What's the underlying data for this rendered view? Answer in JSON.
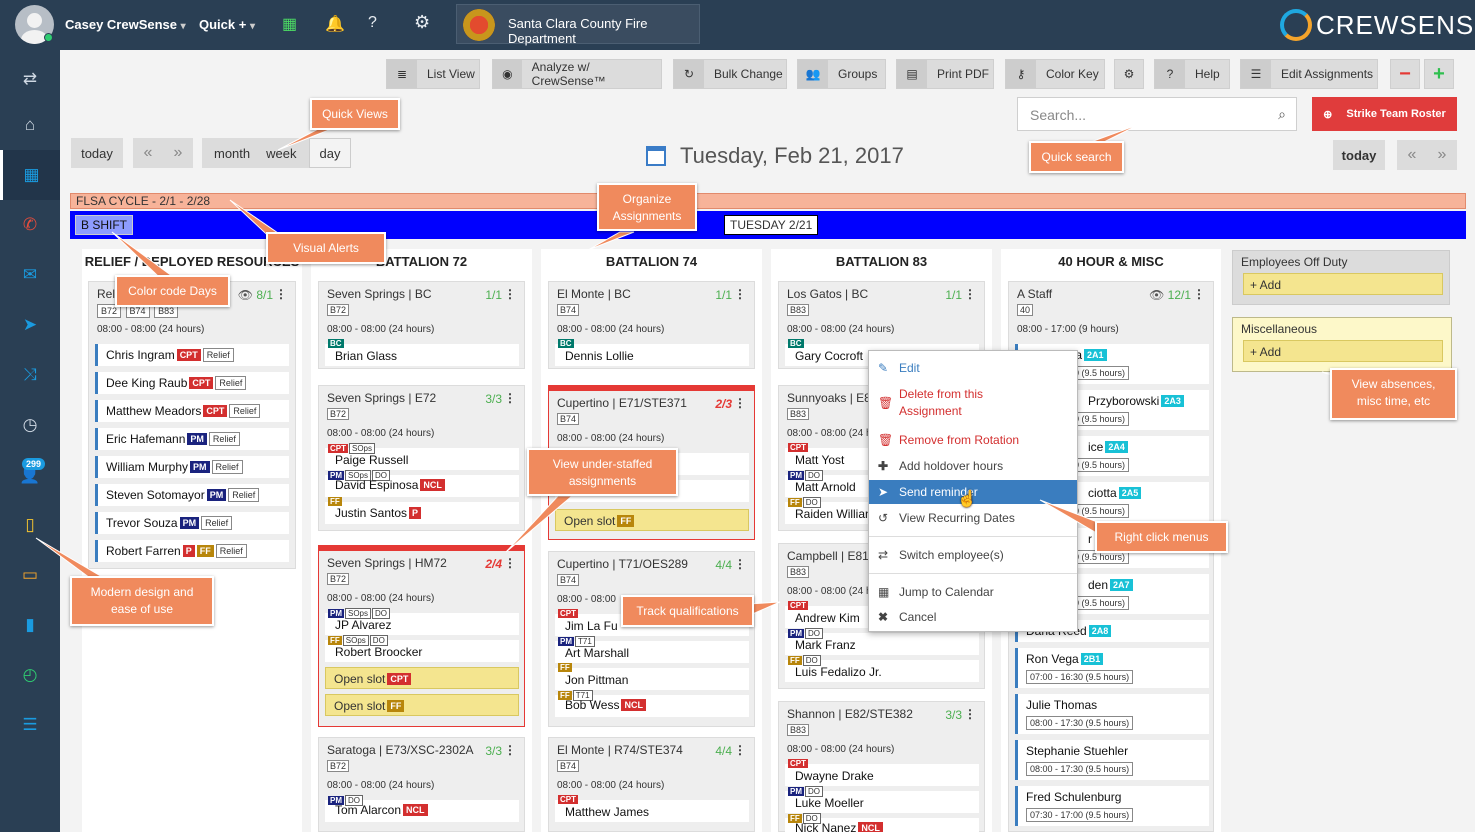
{
  "topbar": {
    "user_name": "Casey CrewSense",
    "user_caret": "▾",
    "quick_label": "Quick +",
    "quick_caret": "▾",
    "department": "Santa Clara County Fire Department",
    "brand": "CREWSENSE"
  },
  "sidebar": {
    "badge_count": "299"
  },
  "toolbar": {
    "list_view": "List View",
    "analyze": "Analyze w/ CrewSense™",
    "bulk_change": "Bulk Change",
    "groups": "Groups",
    "print_pdf": "Print PDF",
    "color_key": "Color Key",
    "help": "Help",
    "edit_assignments": "Edit Assignments",
    "minus": "−",
    "plus": "+"
  },
  "search": {
    "placeholder": "Search..."
  },
  "strike_team": "Strike Team Roster",
  "nav": {
    "today": "today",
    "prev": "«",
    "next": "»",
    "views": [
      "month",
      "week",
      "day"
    ]
  },
  "date_heading": "Tuesday, Feb 21, 2017",
  "flsa_cycle": "FLSA CYCLE - 2/1 - 2/28",
  "shift_label": "B SHIFT",
  "day_label": "TUESDAY 2/21",
  "columns": {
    "relief": "RELIEF / DEPLOYED RESOURCES",
    "b72": "BATTALION 72",
    "b74": "BATTALION 74",
    "b83": "BATTALION 83",
    "misc40": "40 HOUR & MISC"
  },
  "relief_card": {
    "title": "Rel",
    "count": "8/1",
    "apps": [
      "B72",
      "B74",
      "B83"
    ],
    "hours": "08:00 - 08:00 (24 hours)",
    "people": [
      {
        "name": "Chris Ingram",
        "tags": [
          "CPT"
        ]
      },
      {
        "name": "Dee King Raub",
        "tags": [
          "CPT"
        ]
      },
      {
        "name": "Matthew Meadors",
        "tags": [
          "CPT"
        ]
      },
      {
        "name": "Eric Hafemann",
        "tags": [
          "PM"
        ]
      },
      {
        "name": "William Murphy",
        "tags": [
          "PM"
        ]
      },
      {
        "name": "Steven Sotomayor",
        "tags": [
          "PM"
        ]
      },
      {
        "name": "Trevor Souza",
        "tags": [
          "PM"
        ]
      },
      {
        "name": "Robert Farren",
        "tags": [
          "P",
          "FF"
        ]
      }
    ],
    "relief_tag": "Relief"
  },
  "b72": {
    "c1": {
      "title": "Seven Springs | BC",
      "count": "1/1",
      "app": "B72",
      "hours": "08:00 - 08:00 (24 hours)",
      "p1": "Brian Glass"
    },
    "c2": {
      "title": "Seven Springs | E72",
      "count": "3/3",
      "app": "B72",
      "hours": "08:00 - 08:00 (24 hours)",
      "p1": "Paige Russell",
      "p2": "David Espinosa",
      "p3": "Justin Santos"
    },
    "c3": {
      "title": "Seven Springs | HM72",
      "count": "2/4",
      "app": "B72",
      "hours": "08:00 - 08:00 (24 hours)",
      "p1": "JP Alvarez",
      "p2": "Robert Broocker",
      "open1": "Open slot",
      "open2": "Open slot"
    },
    "c4": {
      "title": "Saratoga | E73/XSC-2302A",
      "count": "3/3",
      "app": "B72",
      "hours": "08:00 - 08:00 (24 hours)",
      "p1": "Tom Alarcon"
    }
  },
  "b74": {
    "c1": {
      "title": "El Monte | BC",
      "count": "1/1",
      "app": "B74",
      "hours": "08:00 - 08:00 (24 hours)",
      "p1": "Dennis Lollie"
    },
    "c2": {
      "title": "Cupertino | E71/STE371",
      "count": "2/3",
      "app": "B74",
      "hours": "08:00 - 08:00 (24 hours)",
      "open1": "Open slot"
    },
    "c3": {
      "title": "Cupertino | T71/OES289",
      "count": "4/4",
      "app": "B74",
      "hours": "08:00 - 08:00",
      "p1": "Jim La Fu",
      "p2": "Art Marshall",
      "p3": "Jon Pittman",
      "p4": "Bob Wess"
    },
    "c4": {
      "title": "El Monte | R74/STE374",
      "count": "4/4",
      "app": "B74",
      "hours": "08:00 - 08:00 (24 hours)",
      "p1": "Matthew James"
    }
  },
  "b83": {
    "c1": {
      "title": "Los Gatos | BC",
      "count": "1/1",
      "app": "B83",
      "hours": "08:00 - 08:00 (24 hours)",
      "p1": "Gary Cocroft"
    },
    "c2": {
      "title": "Sunnyoaks | E8",
      "app": "B83",
      "hours": "08:00 - 08:00 (24 h",
      "p1": "Matt Yost",
      "p2": "Matt Arnold",
      "p3": "Raiden Willian"
    },
    "c3": {
      "title": "Campbell | E81",
      "app": "B83",
      "hours": "08:00 - 08:00 (24 h",
      "p1": "Andrew Kim",
      "p2": "Mark Franz",
      "p3": "Luis Fedalizo Jr."
    },
    "c4": {
      "title": "Shannon | E82/STE382",
      "count": "3/3",
      "app": "B83",
      "hours": "08:00 - 08:00 (24 hours)",
      "p1": "Dwayne Drake",
      "p2": "Luke Moeller",
      "p3": "Nick Nanez"
    }
  },
  "misc40": {
    "title": "A Staff",
    "count": "12/1",
    "app": "40",
    "hours": "08:00 - 17:00 (9 hours)",
    "rows": [
      {
        "name": "una",
        "tag": "2A1",
        "hrs": "0 (9.5 hours)"
      },
      {
        "name": "Przyborowski",
        "tag": "2A3",
        "hrs": "0 (9.5 hours)"
      },
      {
        "name": "ice",
        "tag": "2A4",
        "hrs": "0 (9.5 hours)"
      },
      {
        "name": "ciotta",
        "tag": "2A5",
        "hrs": "0 (9.5 hours)"
      },
      {
        "name": "r",
        "tag": "",
        "hrs": "0 (9.5 hours)"
      },
      {
        "name": "den",
        "tag": "2A7",
        "hrs": "0 (9.5 hours)"
      },
      {
        "name": "Dana Reed",
        "tag": "2A8",
        "hrs": ""
      },
      {
        "name": "Ron Vega",
        "tag": "2B1",
        "hrs": "07:00 - 16:30 (9.5 hours)"
      },
      {
        "name": "Julie Thomas",
        "tag": "",
        "hrs": "08:00 - 17:30 (9.5 hours)"
      },
      {
        "name": "Stephanie Stuehler",
        "tag": "",
        "hrs": "08:00 - 17:30 (9.5 hours)"
      },
      {
        "name": "Fred Schulenburg",
        "tag": "",
        "hrs": "07:30 - 17:00 (9.5 hours)"
      }
    ]
  },
  "side": {
    "off_duty": "Employees Off Duty",
    "misc": "Miscellaneous",
    "add": "+ Add"
  },
  "context_menu": {
    "edit": "Edit",
    "delete1": "Delete from this",
    "delete2": "Assignment",
    "remove": "Remove from Rotation",
    "holdover": "Add holdover hours",
    "reminder": "Send reminder",
    "recurring": "View Recurring Dates",
    "switch": "Switch employee(s)",
    "jump": "Jump to Calendar",
    "cancel": "Cancel"
  },
  "callouts": {
    "quick_views": "Quick Views",
    "quick_search": "Quick search",
    "organize": "Organize Assignments",
    "visual_alerts": "Visual Alerts",
    "color_code": "Color code Days",
    "understaffed": "View under-staffed assignments",
    "track_quals": "Track qualifications",
    "right_click": "Right click menus",
    "absences": "View absences, misc time, etc",
    "modern": "Modern design and ease of use"
  },
  "colors": {
    "sidebar": "#2a3f54",
    "shift_bar": "#0000ff",
    "flsa": "#f7b399",
    "callout": "#f08a5d",
    "danger": "#e53935",
    "menu_highlight": "#3a7dbf"
  }
}
